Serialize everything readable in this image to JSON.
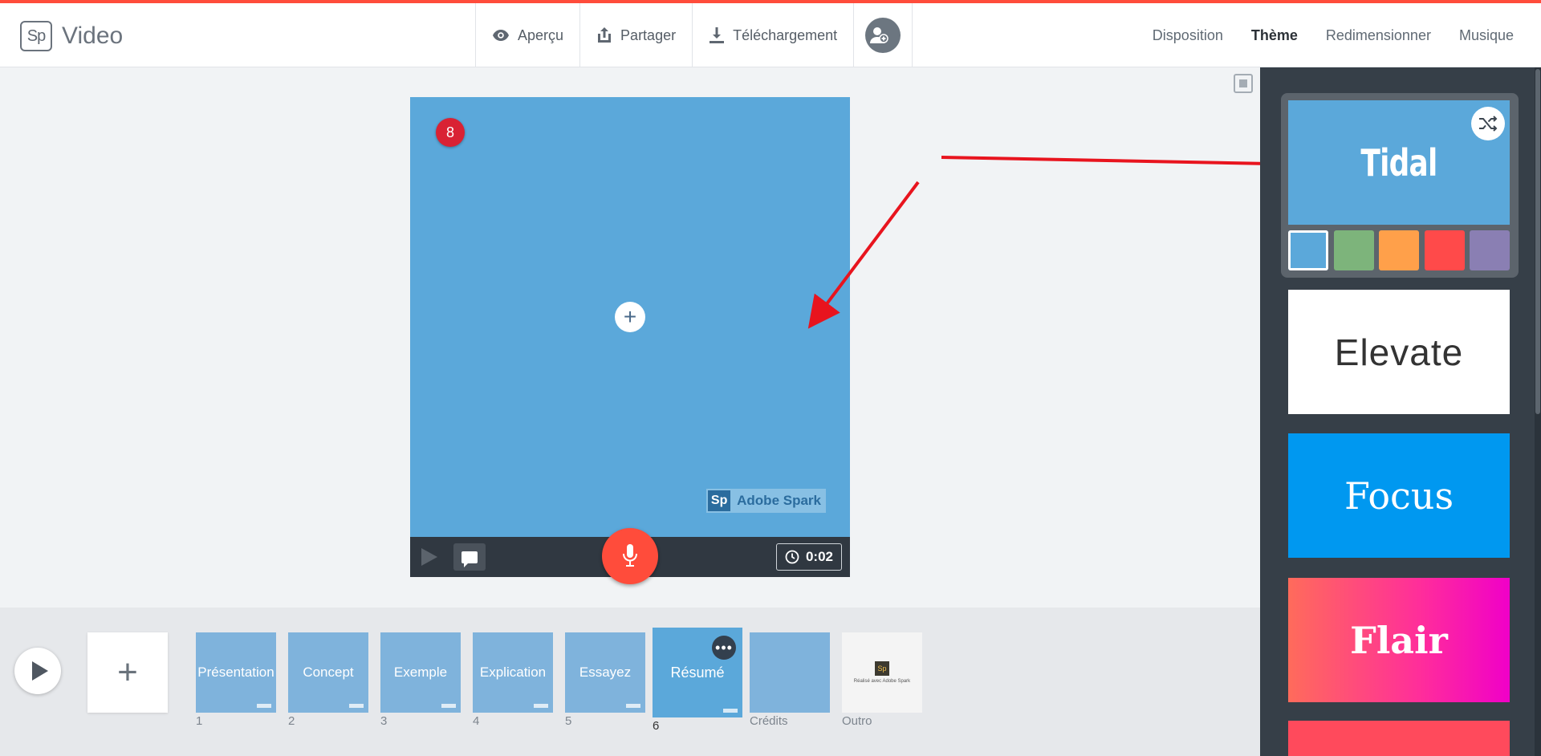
{
  "app": {
    "logo_mark": "Sp",
    "title": "Video"
  },
  "toolbar": {
    "preview": "Aperçu",
    "share": "Partager",
    "download": "Téléchargement"
  },
  "nav": {
    "layout": "Disposition",
    "theme": "Thème",
    "resize": "Redimensionner",
    "music": "Musique"
  },
  "stage": {
    "badge": "8",
    "add_symbol": "+",
    "watermark_mark": "Sp",
    "watermark_text": "Adobe Spark",
    "timer": "0:02",
    "background_color": "#5ba8da"
  },
  "timeline": {
    "add_symbol": "+",
    "slides": [
      {
        "label": "Présentation",
        "num": "1"
      },
      {
        "label": "Concept",
        "num": "2"
      },
      {
        "label": "Exemple",
        "num": "3"
      },
      {
        "label": "Explication",
        "num": "4"
      },
      {
        "label": "Essayez",
        "num": "5"
      },
      {
        "label": "Résumé",
        "num": "6"
      },
      {
        "label": "",
        "num": "Crédits"
      },
      {
        "label": "",
        "num": "Outro"
      }
    ],
    "more_symbol": "•••",
    "outro_mark": "Sp",
    "outro_text": "Réalisé avec Adobe Spark"
  },
  "themes": {
    "items": [
      {
        "name": "Tidal"
      },
      {
        "name": "Elevate"
      },
      {
        "name": "Focus"
      },
      {
        "name": "Flair"
      }
    ],
    "swatches": [
      "#5ba8da",
      "#7db47b",
      "#ffa04a",
      "#ff4a4a",
      "#8a7fb3"
    ]
  },
  "colors": {
    "accent": "#ff4c3b",
    "panel": "#363f48",
    "arrow": "#e8141e"
  }
}
